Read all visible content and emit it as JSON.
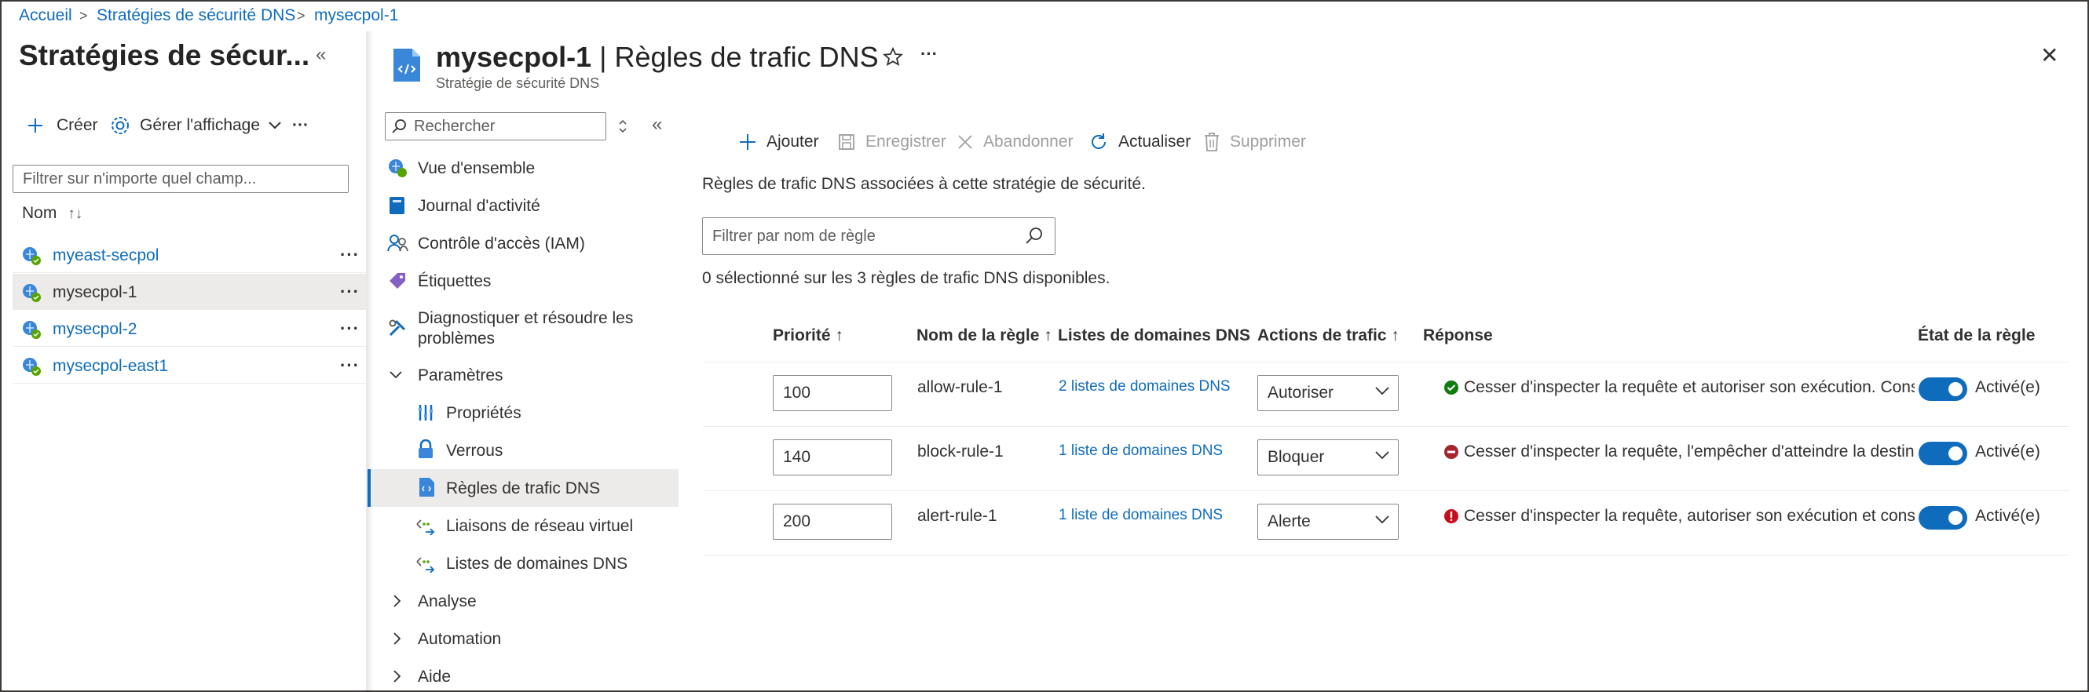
{
  "breadcrumb": [
    "Accueil",
    "Stratégies de sécurité DNS",
    "mysecpol-1"
  ],
  "left_pane": {
    "title": "Stratégies de sécur...",
    "collapse_glyph": "«",
    "toolbar": {
      "create": "Créer",
      "manage_view": "Gérer l'affichage",
      "more": "···"
    },
    "filter_placeholder": "Filtrer sur n'importe quel champ...",
    "column_header": "Nom",
    "sort_glyph": "↑↓",
    "items": [
      {
        "label": "myeast-secpol"
      },
      {
        "label": "mysecpol-1",
        "selected": true
      },
      {
        "label": "mysecpol-2"
      },
      {
        "label": "mysecpol-east1"
      }
    ],
    "row_more": "···"
  },
  "header": {
    "resource": "mysecpol-1",
    "separator": " | ",
    "page": "Règles de trafic DNS",
    "subtitle": "Stratégie de sécurité DNS",
    "more": "···",
    "close": "✕"
  },
  "nav": {
    "search_placeholder": "Rechercher",
    "collapse_glyph": "«",
    "items": [
      {
        "label": "Vue d'ensemble",
        "icon": "overview-icon"
      },
      {
        "label": "Journal d'activité",
        "icon": "activity-log-icon"
      },
      {
        "label": "Contrôle d'accès (IAM)",
        "icon": "iam-icon"
      },
      {
        "label": "Étiquettes",
        "icon": "tag-icon"
      },
      {
        "label": "Diagnostiquer et résoudre les",
        "label2": "problèmes",
        "icon": "wrench-icon"
      },
      {
        "label": "Paramètres",
        "icon": "chevron-down-icon"
      },
      {
        "label": "Propriétés",
        "icon": "properties-icon"
      },
      {
        "label": "Verrous",
        "icon": "lock-icon"
      },
      {
        "label": "Règles de trafic DNS",
        "icon": "dns-rules-icon",
        "selected": true
      },
      {
        "label": "Liaisons de réseau virtuel",
        "icon": "vnet-link-icon"
      },
      {
        "label": "Listes de domaines DNS",
        "icon": "domain-list-icon"
      },
      {
        "label": "Analyse",
        "icon": "chevron-right-icon"
      },
      {
        "label": "Automation",
        "icon": "chevron-right-icon"
      },
      {
        "label": "Aide",
        "icon": "chevron-right-icon"
      }
    ]
  },
  "commands": {
    "add": "Ajouter",
    "save": "Enregistrer",
    "discard": "Abandonner",
    "refresh": "Actualiser",
    "delete": "Supprimer"
  },
  "description": "Règles de trafic DNS associées à cette stratégie de sécurité.",
  "rule_filter_placeholder": "Filtrer par nom de règle",
  "selection_summary": "0 sélectionné sur les 3 règles de trafic DNS disponibles.",
  "table": {
    "headers": {
      "priority": "Priorité ↑",
      "rule_name": "Nom de la règle ↑",
      "domain_lists": "Listes de domaines DNS",
      "traffic_action": "Actions de trafic ↑",
      "response": "Réponse",
      "rule_state": "État de la règle"
    },
    "rows": [
      {
        "priority": "100",
        "name": "allow-rule-1",
        "domain_lists": "2 listes de domaines DNS",
        "action": "Autoriser",
        "response": "Cesser d'inspecter la requête et autoriser son exécution. Consigner la requête.",
        "state": "Activé(e)",
        "status": "success"
      },
      {
        "priority": "140",
        "name": "block-rule-1",
        "domain_lists": "1 liste de domaines DNS",
        "action": "Bloquer",
        "response": "Cesser d'inspecter la requête, l'empêcher d'atteindre la destination prévue.",
        "state": "Activé(e)",
        "status": "blocked"
      },
      {
        "priority": "200",
        "name": "alert-rule-1",
        "domain_lists": "1 liste de domaines DNS",
        "action": "Alerte",
        "response": "Cesser d'inspecter la requête, autoriser son exécution et consigner une alerte.",
        "state": "Activé(e)",
        "status": "alert"
      }
    ]
  },
  "colors": {
    "accent": "#0f6cbd",
    "success": "#107c10",
    "blocked": "#a4262c",
    "alert": "#c50f1f",
    "selected_bg": "#edebe9"
  }
}
